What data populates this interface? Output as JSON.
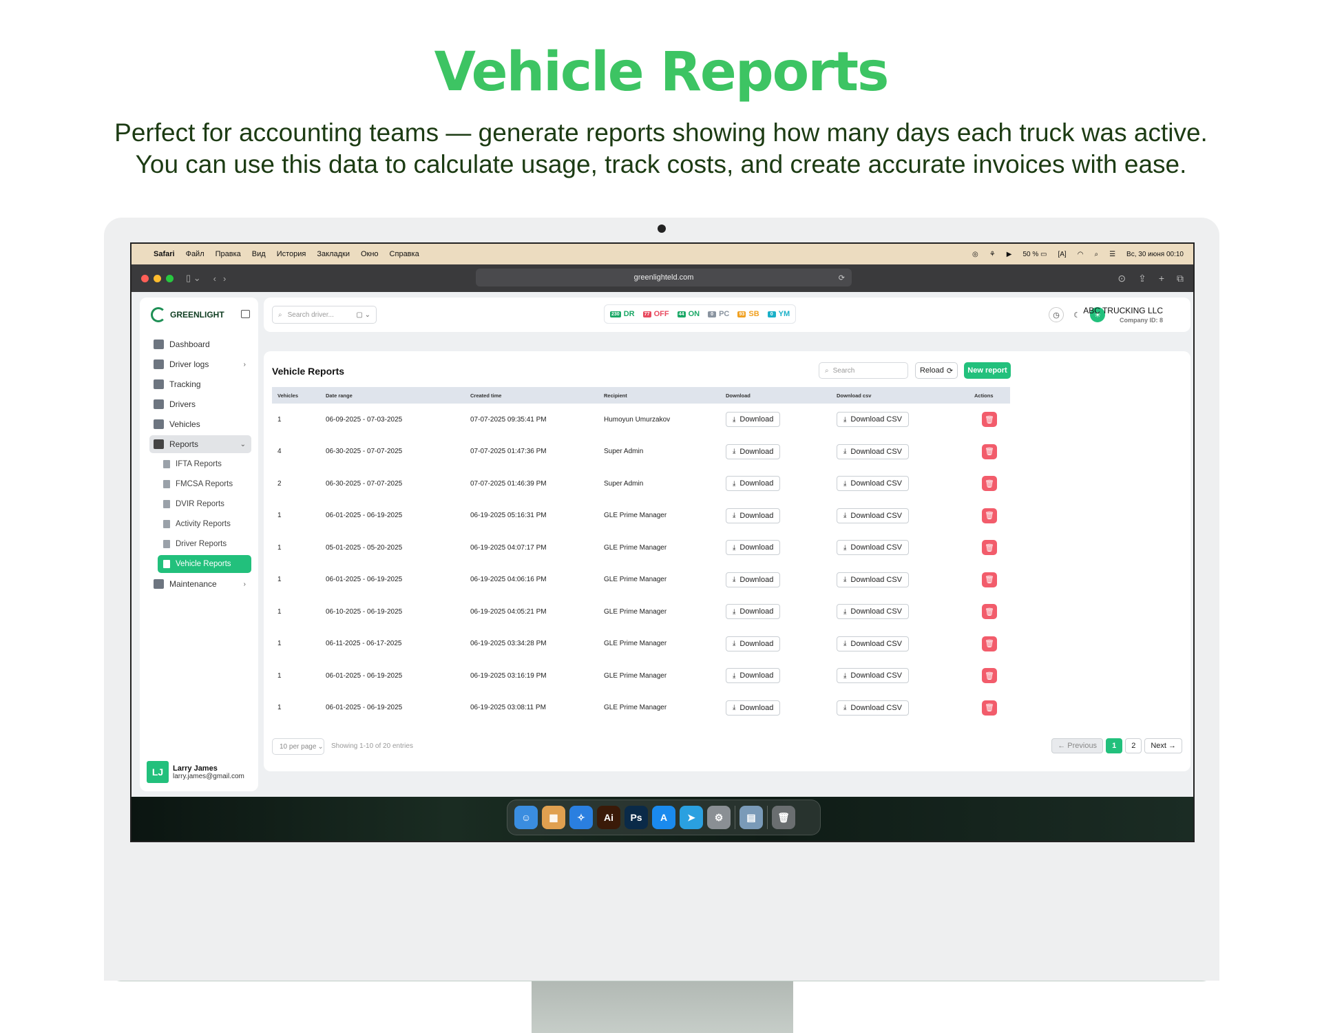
{
  "hero": {
    "title": "Vehicle Reports",
    "line1": "Perfect for accounting teams — generate reports showing how many days each truck was active.",
    "line2": "You can use this data to calculate usage, track costs, and create accurate invoices with ease."
  },
  "menubar": {
    "items": [
      "Safari",
      "Файл",
      "Правка",
      "Вид",
      "История",
      "Закладки",
      "Окно",
      "Справка"
    ],
    "battery": "50 %",
    "clock": "Вс, 30 июня  00:10"
  },
  "browser": {
    "url": "greenlighteld.com"
  },
  "sidebar": {
    "brand": "GREENLIGHT",
    "items": [
      {
        "label": "Dashboard",
        "icon": "dashboard-icon"
      },
      {
        "label": "Driver logs",
        "icon": "driver-logs-icon"
      },
      {
        "label": "Tracking",
        "icon": "map-icon"
      },
      {
        "label": "Drivers",
        "icon": "driver-icon"
      },
      {
        "label": "Vehicles",
        "icon": "truck-icon"
      },
      {
        "label": "Reports",
        "icon": "folder-icon"
      },
      {
        "label": "Maintenance",
        "icon": "layers-icon"
      }
    ],
    "reports_sub": [
      "IFTA Reports",
      "FMCSA Reports",
      "DVIR Reports",
      "Activity Reports",
      "Driver Reports",
      "Vehicle Reports"
    ],
    "user": {
      "initials": "LJ",
      "name": "Larry James",
      "email": "larry.james@gmail.com"
    }
  },
  "topbar": {
    "search_placeholder": "Search driver...",
    "statuses": [
      {
        "count": "230",
        "label": "DR",
        "color": "#1aa866"
      },
      {
        "count": "77",
        "label": "OFF",
        "color": "#e84a5f"
      },
      {
        "count": "44",
        "label": "ON",
        "color": "#1aa866"
      },
      {
        "count": "0",
        "label": "PC",
        "color": "#8a94a0"
      },
      {
        "count": "93",
        "label": "SB",
        "color": "#f0a020"
      },
      {
        "count": "0",
        "label": "YM",
        "color": "#1ab0c8"
      }
    ],
    "company": "ABC TRUCKING LLC",
    "company_id": "Company ID: 8"
  },
  "page": {
    "title": "Vehicle Reports",
    "search_placeholder": "Search",
    "reload_label": "Reload",
    "new_label": "New report",
    "download_label": "Download",
    "download_csv_label": "Download CSV"
  },
  "table": {
    "headers": [
      "Vehicles",
      "Date range",
      "Created time",
      "Recipient",
      "Download",
      "Download csv",
      "Actions"
    ],
    "rows": [
      {
        "vehicles": "1",
        "range": "06-09-2025 - 07-03-2025",
        "created": "07-07-2025 09:35:41 PM",
        "recipient": "Humoyun Umurzakov"
      },
      {
        "vehicles": "4",
        "range": "06-30-2025 - 07-07-2025",
        "created": "07-07-2025 01:47:36 PM",
        "recipient": "Super Admin"
      },
      {
        "vehicles": "2",
        "range": "06-30-2025 - 07-07-2025",
        "created": "07-07-2025 01:46:39 PM",
        "recipient": "Super Admin"
      },
      {
        "vehicles": "1",
        "range": "06-01-2025 - 06-19-2025",
        "created": "06-19-2025 05:16:31 PM",
        "recipient": "GLE Prime Manager"
      },
      {
        "vehicles": "1",
        "range": "05-01-2025 - 05-20-2025",
        "created": "06-19-2025 04:07:17 PM",
        "recipient": "GLE Prime Manager"
      },
      {
        "vehicles": "1",
        "range": "06-01-2025 - 06-19-2025",
        "created": "06-19-2025 04:06:16 PM",
        "recipient": "GLE Prime Manager"
      },
      {
        "vehicles": "1",
        "range": "06-10-2025 - 06-19-2025",
        "created": "06-19-2025 04:05:21 PM",
        "recipient": "GLE Prime Manager"
      },
      {
        "vehicles": "1",
        "range": "06-11-2025 - 06-17-2025",
        "created": "06-19-2025 03:34:28 PM",
        "recipient": "GLE Prime Manager"
      },
      {
        "vehicles": "1",
        "range": "06-01-2025 - 06-19-2025",
        "created": "06-19-2025 03:16:19 PM",
        "recipient": "GLE Prime Manager"
      },
      {
        "vehicles": "1",
        "range": "06-01-2025 - 06-19-2025",
        "created": "06-19-2025 03:08:11 PM",
        "recipient": "GLE Prime Manager"
      }
    ]
  },
  "footer": {
    "per_page": "10 per page",
    "showing": "Showing 1-10 of 20 entries",
    "prev": "← Previous",
    "pages": [
      "1",
      "2"
    ],
    "next": "Next →"
  },
  "dock": {
    "apps": [
      {
        "name": "finder-icon",
        "glyph": "☺",
        "color": "#3a8de0"
      },
      {
        "name": "launchpad-icon",
        "glyph": "▦",
        "color": "#e0a050"
      },
      {
        "name": "safari-icon",
        "glyph": "✧",
        "color": "#2a7fe0"
      },
      {
        "name": "illustrator-icon",
        "glyph": "Ai",
        "color": "#3a1a08"
      },
      {
        "name": "photoshop-icon",
        "glyph": "Ps",
        "color": "#0a2a48"
      },
      {
        "name": "app-store-icon",
        "glyph": "A",
        "color": "#1a8aee"
      },
      {
        "name": "telegram-icon",
        "glyph": "➤",
        "color": "#2aa0e0"
      },
      {
        "name": "settings-icon",
        "glyph": "⚙",
        "color": "#8a8f94"
      },
      {
        "name": "preview-icon",
        "glyph": "▤",
        "color": "#7a9ab8"
      },
      {
        "name": "trash-icon",
        "glyph": "🗑",
        "color": "#6a6e70"
      }
    ]
  },
  "colors": {
    "accent": "#22c07c",
    "hero": "#3dc463",
    "danger": "#f25c6b"
  }
}
